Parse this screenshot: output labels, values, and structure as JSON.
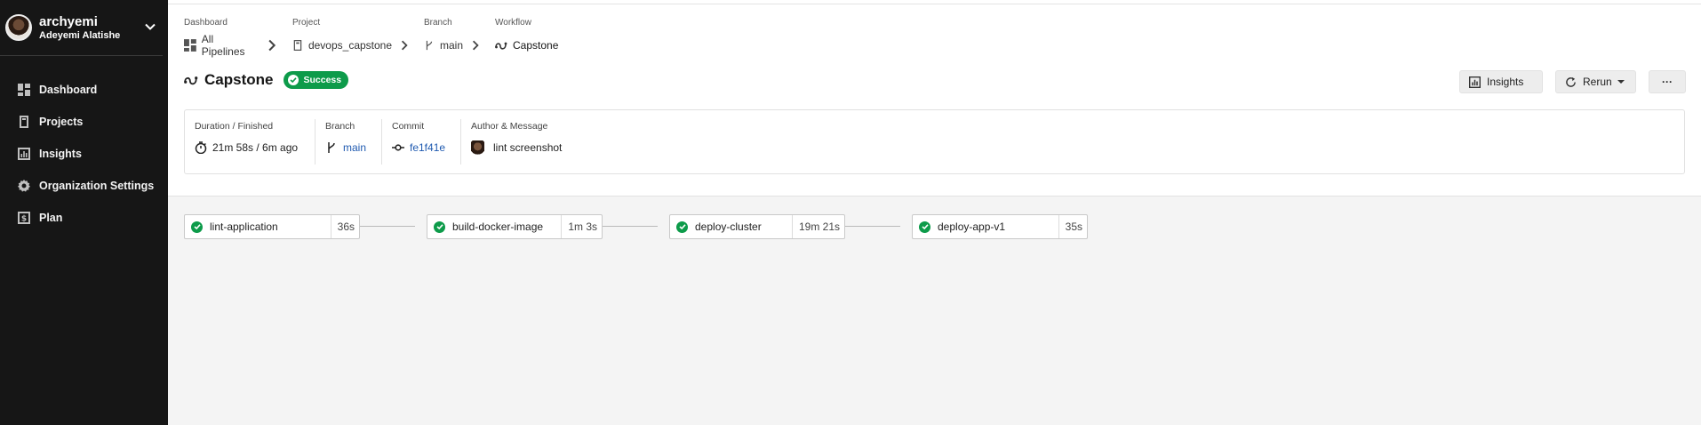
{
  "sidebar": {
    "org_name": "archyemi",
    "org_user": "Adeyemi Alatishe",
    "items": [
      {
        "label": "Dashboard",
        "icon": "dashboard-icon"
      },
      {
        "label": "Projects",
        "icon": "projects-icon"
      },
      {
        "label": "Insights",
        "icon": "insights-icon"
      },
      {
        "label": "Organization Settings",
        "icon": "gear-icon"
      },
      {
        "label": "Plan",
        "icon": "plan-icon"
      }
    ]
  },
  "breadcrumb": [
    {
      "label": "Dashboard",
      "value": "All Pipelines",
      "icon": "dashboard-icon"
    },
    {
      "label": "Project",
      "value": "devops_capstone",
      "icon": "project-icon"
    },
    {
      "label": "Branch",
      "value": "main",
      "icon": "branch-icon"
    },
    {
      "label": "Workflow",
      "value": "Capstone",
      "icon": "workflow-icon"
    }
  ],
  "header": {
    "title": "Capstone",
    "status": "Success",
    "status_color": "#0d9b4a"
  },
  "actions": {
    "insights": "Insights",
    "rerun": "Rerun",
    "more": "···"
  },
  "info": {
    "duration_label": "Duration / Finished",
    "duration_value": "21m 58s / 6m ago",
    "branch_label": "Branch",
    "branch_value": "main",
    "commit_label": "Commit",
    "commit_value": "fe1f41e",
    "author_label": "Author & Message",
    "author_message": "lint screenshot"
  },
  "jobs": [
    {
      "name": "lint-application",
      "duration": "36s"
    },
    {
      "name": "build-docker-image",
      "duration": "1m 3s"
    },
    {
      "name": "deploy-cluster",
      "duration": "19m 21s"
    },
    {
      "name": "deploy-app-v1",
      "duration": "35s"
    }
  ]
}
